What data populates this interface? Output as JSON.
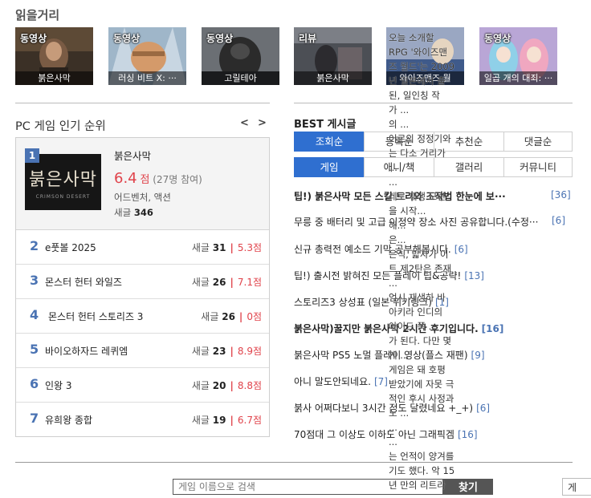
{
  "reading": {
    "title": "읽을거리",
    "cards": [
      {
        "tag": "동영상",
        "caption": "붉은사막"
      },
      {
        "tag": "동영상",
        "caption": "러싱 비트 X: ···"
      },
      {
        "tag": "동영상",
        "caption": "고릴테아"
      },
      {
        "tag": "리뷰",
        "caption": "붉은사막"
      },
      {
        "tag": "",
        "caption": "와이즈맨즈 월"
      },
      {
        "tag": "동영상",
        "caption": "일곱 개의 대죄: ···"
      }
    ],
    "overflow_lines": [
      "오늘 소개할",
      "RPG '와이즈맨",
      "즈 월드'는 2009",
      "년 일본에서 출",
      "된, 일인칭 작",
      "가 ...",
      "의 ...",
      "어르의 정정기와",
      "는 다소 거리가",
      "...",
      "...",
      "레로 재생 모련",
      "을 시작...",
      "해...",
      "은...",
      "은식, 밟자가 이",
      "트 제2탄은 존재",
      "...",
      "엄시 재생하 바",
      "아키라 인디의",
      "아이드 쪽 ...",
      "가 된다. 다만 몇",
      "게 ...",
      "게임은 돼 호평",
      "받았기에 자못 극",
      "적인 후시 사정과",
      "도 ...",
      "...",
      "...",
      "는 언적이 양겨를",
      "기도 했다. 악 15",
      "년 만의 리트라"
    ]
  },
  "ranking": {
    "title": "PC 게임 인기 순위",
    "prev": "<",
    "next": ">",
    "top": {
      "rank": "1",
      "cover_title": "붉은사막",
      "cover_sub": "CRIMSON DESERT",
      "name": "붉은사막",
      "score": "6.4",
      "score_unit": "점",
      "participants": "(27명 참여)",
      "genre": "어드벤처, 액션",
      "count_label": "새글",
      "count": "346"
    },
    "rows": [
      {
        "rank": "2",
        "name": "e풋볼 2025",
        "count_label": "새글",
        "count": "31",
        "score": "5.3점"
      },
      {
        "rank": "3",
        "name": "몬스터 헌터 와일즈",
        "count_label": "새글",
        "count": "26",
        "score": "7.1점"
      },
      {
        "rank": "4",
        "name": "몬스터 헌터 스토리즈 3",
        "count_label": "새글",
        "count": "26",
        "score": "0점"
      },
      {
        "rank": "5",
        "name": "바이오하자드 레퀴엠",
        "count_label": "새글",
        "count": "23",
        "score": "8.9점"
      },
      {
        "rank": "6",
        "name": "인왕 3",
        "count_label": "새글",
        "count": "20",
        "score": "8.8점"
      },
      {
        "rank": "7",
        "name": "유희왕 종합",
        "count_label": "새글",
        "count": "19",
        "score": "6.7점"
      }
    ]
  },
  "best": {
    "title": "BEST 게시글",
    "sort_tabs": [
      "조회순",
      "등록순",
      "추천순",
      "댓글순"
    ],
    "cat_tabs": [
      "게임",
      "애니/책",
      "갤러리",
      "커뮤니티"
    ],
    "posts": [
      {
        "title": "팁!) 붉은사막 모든 스킬 트리와 조작법 한눈에 보···",
        "count": "[36]",
        "bold": true
      },
      {
        "title": "무릉 중 배터리 및 고급 이정약 장소 사진 공유합니다.(수정···",
        "count": "[6]",
        "bold": false
      },
      {
        "title": "신규 총력전 예소드 기막 공부해봅시다.",
        "count": "[6]",
        "bold": false
      },
      {
        "title": "팁!) 출시전 밝혀진 모든 플레이 팁&공략!",
        "count": "[13]",
        "bold": false
      },
      {
        "title": "스토리즈3 상성표 (일본 위키링크)",
        "count": "[1]",
        "bold": false
      },
      {
        "title": "붉은사막)꿀지만 붉은사막 2시간 후기입니다.",
        "count": "[16]",
        "bold": true
      },
      {
        "title": "붉은사막 PS5 노멀 플레이 영상(플스 재팬)",
        "count": "[9]",
        "bold": false
      },
      {
        "title": "아니 말도안되네요.",
        "count": "[7]",
        "bold": false
      },
      {
        "title": "붉사 어쩌다보니 3시간 정도 달렸네요 +_+)",
        "count": "[6]",
        "bold": false
      },
      {
        "title": "70점대 그 이상도 이하도 아닌 그래픽겜",
        "count": "[16]",
        "bold": false
      }
    ]
  },
  "search": {
    "placeholder": "게임 이름으로 검색",
    "button": "찾기",
    "corner_button": "게"
  },
  "colors": {
    "accent": "#2f6fd0",
    "rank_blue": "#4a73b3",
    "score_red": "#e0434b"
  }
}
